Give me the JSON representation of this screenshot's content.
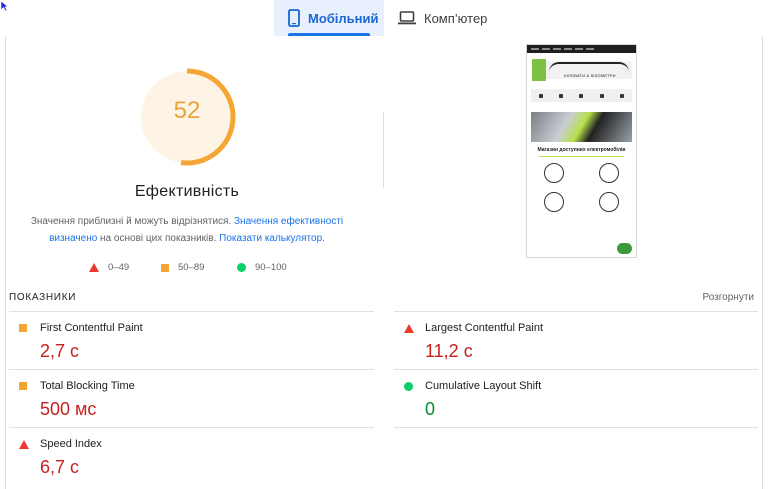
{
  "tabs": {
    "mobile": "Мобільний",
    "desktop": "Комп’ютер"
  },
  "performance": {
    "score": "52",
    "title": "Ефективність",
    "note_plain_1": "Значення приблизні й можуть відрізнятися. ",
    "note_link_1": "Значення ефективності визначено",
    "note_plain_2": " на основі цих показників. ",
    "note_link_2": "Показати калькулятор."
  },
  "legend": [
    {
      "range": "0–49",
      "marker": "red-triangle"
    },
    {
      "range": "50–89",
      "marker": "orange-square"
    },
    {
      "range": "90–100",
      "marker": "green-circle"
    }
  ],
  "screenshot": {
    "logo_caption": "КІЛОВАТИ & КІЛОМЕТРИ",
    "heading": "Магазин доступних електромобілів"
  },
  "metrics_section": {
    "title": "ПОКАЗНИКИ",
    "expand_label": "Розгорнути"
  },
  "metrics": {
    "fcp": {
      "name": "First Contentful Paint",
      "value": "2,7 с",
      "status": "average"
    },
    "lcp": {
      "name": "Largest Contentful Paint",
      "value": "11,2 с",
      "status": "fail"
    },
    "tbt": {
      "name": "Total Blocking Time",
      "value": "500 мс",
      "status": "average"
    },
    "cls": {
      "name": "Cumulative Layout Shift",
      "value": "0",
      "status": "pass"
    },
    "si": {
      "name": "Speed Index",
      "value": "6,7 с",
      "status": "fail"
    }
  },
  "colors": {
    "fail": "#eb3a2d",
    "average": "#f5a533",
    "pass": "#0cce6b",
    "accent": "#1a73e8"
  }
}
